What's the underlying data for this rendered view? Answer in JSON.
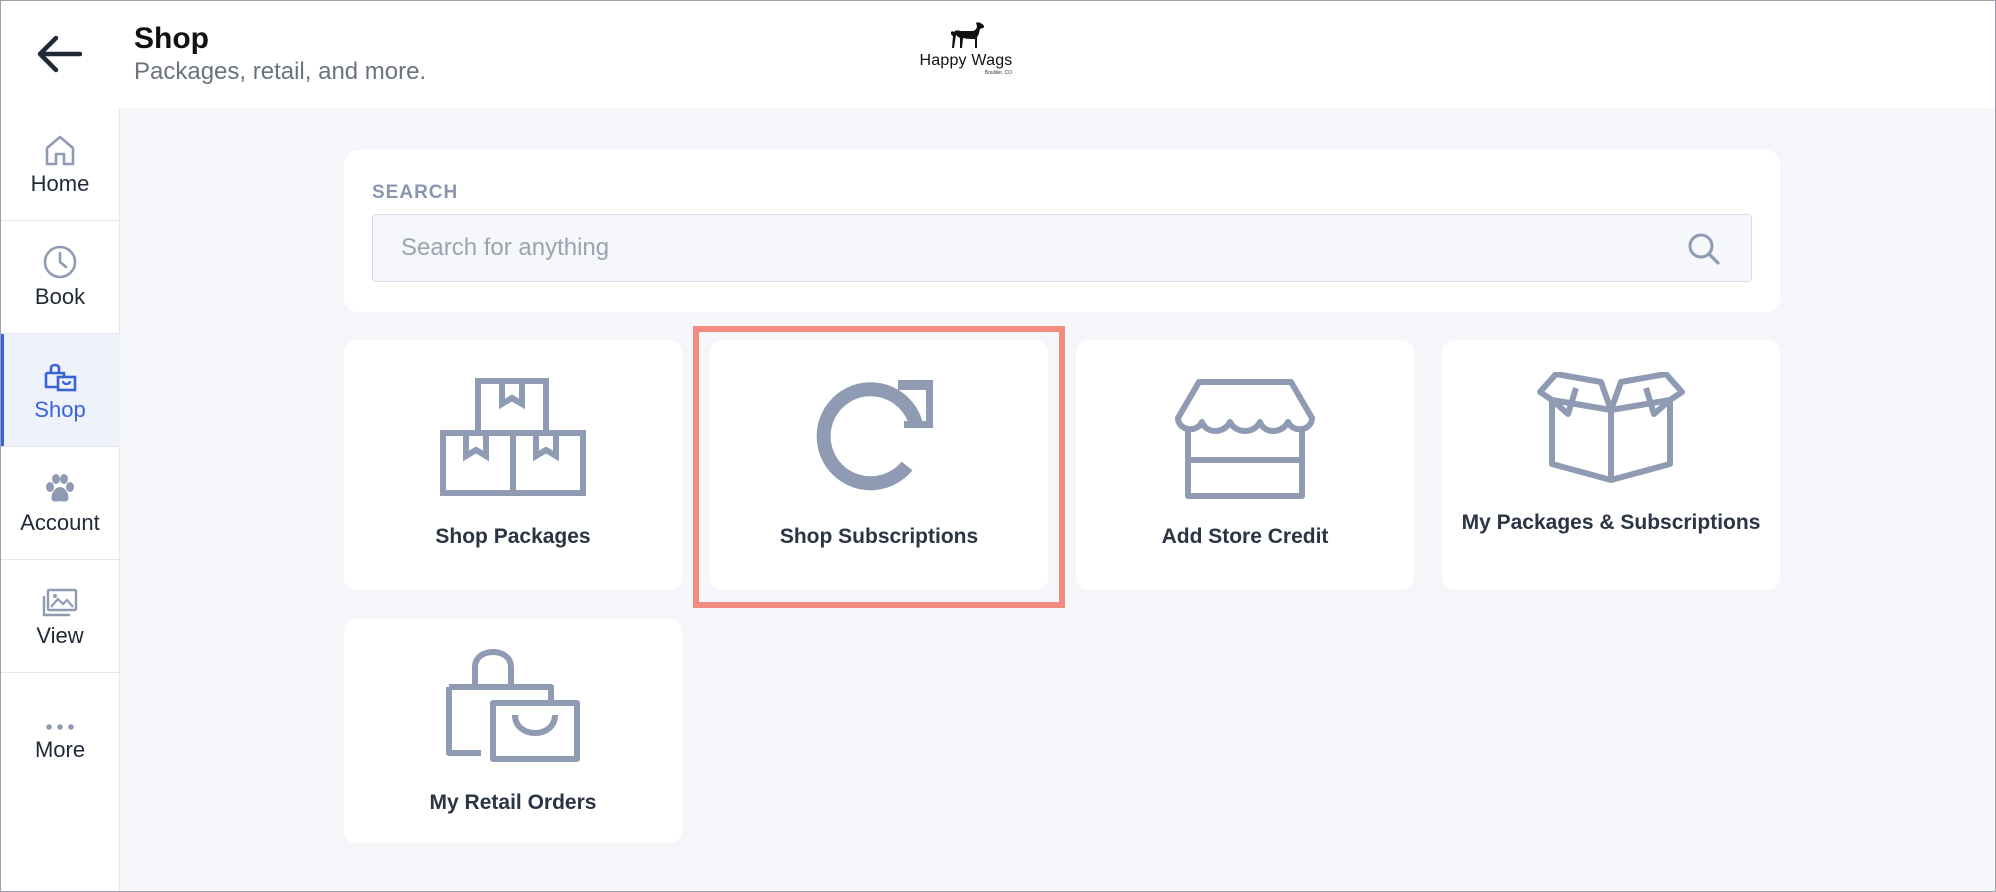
{
  "header": {
    "title": "Shop",
    "subtitle": "Packages, retail, and more.",
    "logo_name": "Happy Wags",
    "logo_location": "Boulder, CO"
  },
  "sidebar": {
    "items": [
      {
        "label": "Home",
        "icon": "home-icon"
      },
      {
        "label": "Book",
        "icon": "clock-icon"
      },
      {
        "label": "Shop",
        "icon": "shopping-bag-icon",
        "active": true
      },
      {
        "label": "Account",
        "icon": "paw-icon"
      },
      {
        "label": "View",
        "icon": "image-gallery-icon"
      },
      {
        "label": "More",
        "icon": "more-dots-icon"
      }
    ]
  },
  "search": {
    "label": "SEARCH",
    "placeholder": "Search for anything",
    "value": ""
  },
  "tiles": [
    {
      "label": "Shop Packages",
      "icon": "boxes-icon"
    },
    {
      "label": "Shop Subscriptions",
      "icon": "refresh-icon"
    },
    {
      "label": "Add Store Credit",
      "icon": "storefront-icon"
    },
    {
      "label": "My Packages & Subscriptions",
      "icon": "open-box-icon"
    },
    {
      "label": "My Retail Orders",
      "icon": "shopping-bags-icon"
    }
  ],
  "colors": {
    "accent": "#3b63d8",
    "icon_gray": "#8f9bb3",
    "highlight": "#f28b82",
    "background": "#f6f6fa"
  }
}
